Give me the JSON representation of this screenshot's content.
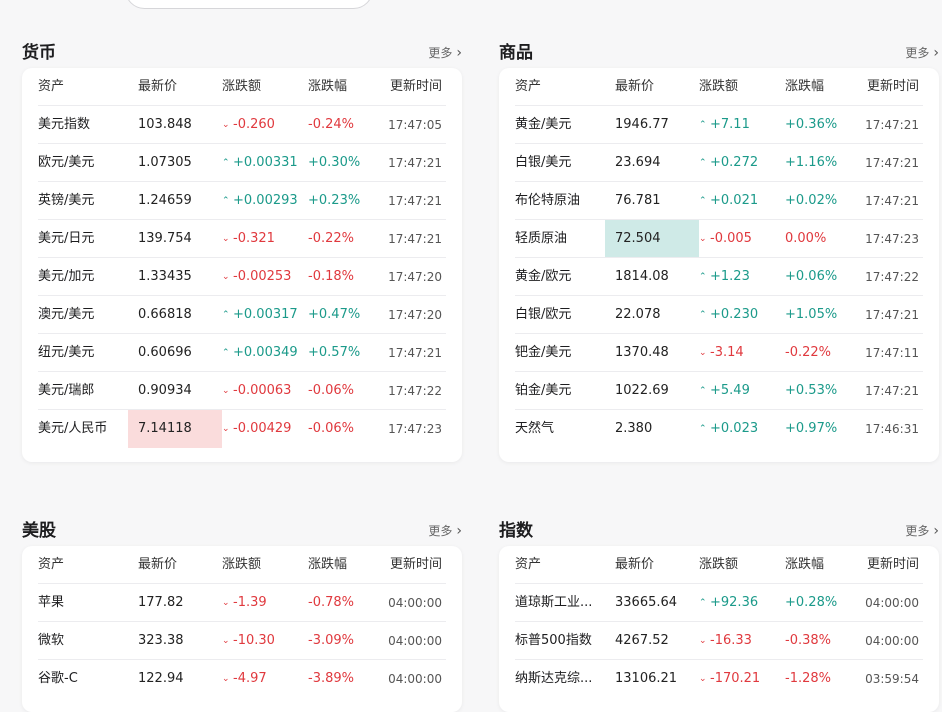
{
  "sections": [
    {
      "title": "货币",
      "more": "更多",
      "headers": [
        "资产",
        "最新价",
        "涨跌额",
        "涨跌幅",
        "更新时间"
      ],
      "rows": [
        {
          "name": "美元指数",
          "price": "103.848",
          "change": "-0.260",
          "pct": "-0.24%",
          "time": "17:47:05",
          "dir": "down"
        },
        {
          "name": "欧元/美元",
          "price": "1.07305",
          "change": "+0.00331",
          "pct": "+0.30%",
          "time": "17:47:21",
          "dir": "up"
        },
        {
          "name": "英镑/美元",
          "price": "1.24659",
          "change": "+0.00293",
          "pct": "+0.23%",
          "time": "17:47:21",
          "dir": "up"
        },
        {
          "name": "美元/日元",
          "price": "139.754",
          "change": "-0.321",
          "pct": "-0.22%",
          "time": "17:47:21",
          "dir": "down"
        },
        {
          "name": "美元/加元",
          "price": "1.33435",
          "change": "-0.00253",
          "pct": "-0.18%",
          "time": "17:47:20",
          "dir": "down"
        },
        {
          "name": "澳元/美元",
          "price": "0.66818",
          "change": "+0.00317",
          "pct": "+0.47%",
          "time": "17:47:20",
          "dir": "up"
        },
        {
          "name": "纽元/美元",
          "price": "0.60696",
          "change": "+0.00349",
          "pct": "+0.57%",
          "time": "17:47:21",
          "dir": "up"
        },
        {
          "name": "美元/瑞郎",
          "price": "0.90934",
          "change": "-0.00063",
          "pct": "-0.06%",
          "time": "17:47:22",
          "dir": "down"
        },
        {
          "name": "美元/人民币",
          "price": "7.14118",
          "change": "-0.00429",
          "pct": "-0.06%",
          "time": "17:47:23",
          "dir": "down",
          "highlight": "red"
        }
      ]
    },
    {
      "title": "商品",
      "more": "更多",
      "headers": [
        "资产",
        "最新价",
        "涨跌额",
        "涨跌幅",
        "更新时间"
      ],
      "rows": [
        {
          "name": "黄金/美元",
          "price": "1946.77",
          "change": "+7.11",
          "pct": "+0.36%",
          "time": "17:47:21",
          "dir": "up"
        },
        {
          "name": "白银/美元",
          "price": "23.694",
          "change": "+0.272",
          "pct": "+1.16%",
          "time": "17:47:21",
          "dir": "up"
        },
        {
          "name": "布伦特原油",
          "price": "76.781",
          "change": "+0.021",
          "pct": "+0.02%",
          "time": "17:47:21",
          "dir": "up"
        },
        {
          "name": "轻质原油",
          "price": "72.504",
          "change": "-0.005",
          "pct": "0.00%",
          "time": "17:47:23",
          "dir": "down",
          "highlight": "teal"
        },
        {
          "name": "黄金/欧元",
          "price": "1814.08",
          "change": "+1.23",
          "pct": "+0.06%",
          "time": "17:47:22",
          "dir": "up"
        },
        {
          "name": "白银/欧元",
          "price": "22.078",
          "change": "+0.230",
          "pct": "+1.05%",
          "time": "17:47:21",
          "dir": "up"
        },
        {
          "name": "钯金/美元",
          "price": "1370.48",
          "change": "-3.14",
          "pct": "-0.22%",
          "time": "17:47:11",
          "dir": "down"
        },
        {
          "name": "铂金/美元",
          "price": "1022.69",
          "change": "+5.49",
          "pct": "+0.53%",
          "time": "17:47:21",
          "dir": "up"
        },
        {
          "name": "天然气",
          "price": "2.380",
          "change": "+0.023",
          "pct": "+0.97%",
          "time": "17:46:31",
          "dir": "up"
        }
      ]
    },
    {
      "title": "美股",
      "more": "更多",
      "headers": [
        "资产",
        "最新价",
        "涨跌额",
        "涨跌幅",
        "更新时间"
      ],
      "rows": [
        {
          "name": "苹果",
          "price": "177.82",
          "change": "-1.39",
          "pct": "-0.78%",
          "time": "04:00:00",
          "dir": "down"
        },
        {
          "name": "微软",
          "price": "323.38",
          "change": "-10.30",
          "pct": "-3.09%",
          "time": "04:00:00",
          "dir": "down"
        },
        {
          "name": "谷歌-C",
          "price": "122.94",
          "change": "-4.97",
          "pct": "-3.89%",
          "time": "04:00:00",
          "dir": "down"
        }
      ]
    },
    {
      "title": "指数",
      "more": "更多",
      "headers": [
        "资产",
        "最新价",
        "涨跌额",
        "涨跌幅",
        "更新时间"
      ],
      "rows": [
        {
          "name": "道琼斯工业...",
          "price": "33665.64",
          "change": "+92.36",
          "pct": "+0.28%",
          "time": "04:00:00",
          "dir": "up"
        },
        {
          "name": "标普500指数",
          "price": "4267.52",
          "change": "-16.33",
          "pct": "-0.38%",
          "time": "04:00:00",
          "dir": "down"
        },
        {
          "name": "纳斯达克综...",
          "price": "13106.21",
          "change": "-170.21",
          "pct": "-1.28%",
          "time": "03:59:54",
          "dir": "down"
        }
      ]
    }
  ],
  "icons": {
    "more": "chevron-right-icon",
    "up": "caret-up-icon",
    "down": "caret-down-icon"
  },
  "colors": {
    "up": "#1b9a8a",
    "down": "#e0393e",
    "highlight_red": "#fadcdc",
    "highlight_teal": "#cfeae7"
  }
}
